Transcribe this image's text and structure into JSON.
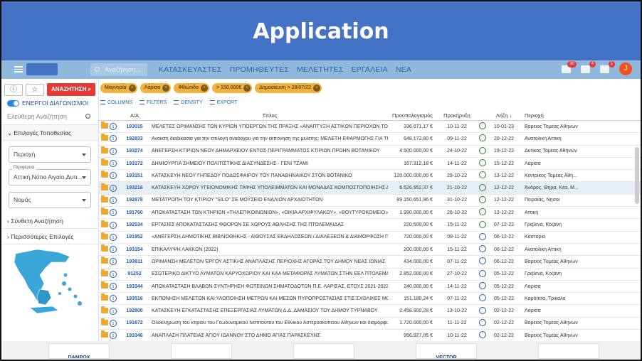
{
  "banner_title": "Application",
  "topbar": {
    "search_placeholder": "Αναζήτηση...",
    "nav": [
      "ΚΑΤΑΣΚΕΥΑΣΤΕΣ",
      "ΠΡΟΜΗΘΕΥΤΕΣ",
      "ΜΕΛΕΤΗΤΕΣ",
      "ΕΡΓΑΛΕΙΑ",
      "ΝΕΑ"
    ],
    "badges": {
      "messages": "30",
      "mail": "4",
      "bell": "1"
    },
    "avatar": "J"
  },
  "sidebar": {
    "search_button": "ΑΝΑΖΗΤΗΣΗ",
    "active_toggle": "ΕΝΕΡΓΟΙ ΔΙΑΓΩΝΙΣΜΟΙ",
    "free_search": "Ελεύθερη Αναζήτηση",
    "location_section": "Επιλογές Τοποθεσίας",
    "region_placeholder": "Περιοχή",
    "periphery_label": "Περιφέρεια",
    "periphery_value": "Αττική,Νότιο Αιγαίο,Δυτι...",
    "nomos_placeholder": "Νομός",
    "complex_search": "Σύνθετη Αναζήτηση",
    "more_options": "Περισσότερες Επιλογές"
  },
  "filters": [
    "Μαγνησία",
    "Λάρισα",
    "Φθιώτιδα",
    "> 150.000€",
    "Δημοσίευση > 28/07/22"
  ],
  "tools": [
    "COLUMNS",
    "FILTERS",
    "DENSITY",
    "EXPORT"
  ],
  "columns": {
    "aa": "Α/Α",
    "title": "Τίτλος",
    "budget": "Προϋπολογισμός",
    "notice": "Προκήρυξη",
    "expiry": "Λήξη",
    "region": "Περιοχή"
  },
  "rows": [
    {
      "id": "193015",
      "title": "ΜΕΛΕΤΕΣ ΩΡΙΜΑΝΣΗΣ ΤΩΝ ΚΥΡΙΩΝ ΥΠΟΕΡΓΩΝ ΤΗΣ ΠΡΑΞΗΣ «ΑΝΑΠΤΥΞΗ ΑΣΤΙΚΩΝ ΠΕΡΙΟΧΩΝ ΤΟΥ Δ...",
      "budget": "336.671,17 €",
      "notice": "10-11-22",
      "expiry": "10-01-23",
      "region": "Βόρειος Τομέας Αθηνών",
      "color": "green"
    },
    {
      "id": "192833",
      "title": "Ανοικτή διαδικασία για την επιλογή αναδόχου για την εκπόνηση της μελέτης: ΜΕΛΕΤΗ ΕΦΑΡΜΟΓΗΣ ΓΙΑ ΤΗΝ",
      "budget": "648.172,80 €",
      "notice": "09-11-22",
      "expiry": "20-12-22",
      "region": "Ανατολική Αττική",
      "color": "green"
    },
    {
      "id": "193274",
      "title": "ΑΝΕΓΕΡΣΗ ΚΤΙΡΙΩΝ ΝΕΟΥ ΔΗΜΑΡΧΕΙΟΥ ΕΝΤΟΣ ΠΕΡΙΓΡΑΜΜΑΤΟΣ ΚΤΙΡΙΩΝ ΠΡΩΗΝ ΒΟΤΑΝΙΚΟΥ",
      "budget": "4.500.000,00 €",
      "notice": "24-10-22",
      "expiry": "19-12-22",
      "region": "Δυτικός Τομέας Αθηνών",
      "color": "green"
    },
    {
      "id": "193172",
      "title": "ΔΗΜΙΟΥΡΓΙΑ ΣΗΜΕΙΟΥ ΠΟΛΙΤΙΣΤΙΚΗΣ ΔΙΑΣΥΝΔΕΣΗΣ - ΓΕΝΙ ΤΖΑΜΙ",
      "budget": "167.312,18 €",
      "notice": "14-11-22",
      "expiry": "15-12-22",
      "region": "Λάρισα",
      "color": "green"
    },
    {
      "id": "193151",
      "title": "ΚΑΤΑΣΚΕΥΗ ΝΕΟΥ ΓΗΠΕΔΟΥ ΠΟΔΟΣΦΑΙΡΟΥ ΤΟΥ ΠΑΝΑΘΗΝΑΪΚΟΥ ΣΤΟΝ ΒΟΤΑΝΙΚΟ",
      "budget": "120.000.000,00 €",
      "notice": "29-10-22",
      "expiry": "13-12-22",
      "region": "Κεντρικός Τομέας Αθη...",
      "color": "green"
    },
    {
      "id": "193216",
      "title": "ΚΑΤΑΣΚΕΥΗ ΧΩΡΟΥ ΥΓΕΙΟΝΟΜΙΚΗΣ ΤΑΦΗΣ ΥΠΟΛΕΙΜΜΑΤΩΝ ΚΑΙ ΜΟΝΑΔΑΣ ΚΟΜΠΟΣΤΟΠΟΙΗΣΗΣ ΔΗ...",
      "budget": "6.526.952,37 €",
      "notice": "21-10-22",
      "expiry": "12-12-22",
      "region": "Άνδρος, Θήρα, Κέα, Μ...",
      "color": "green"
    },
    {
      "id": "192878",
      "title": "ΜΕΤΑΤΡΟΠΗ ΤΟΥ ΚΤΙΡΙΟΥ \"SILO\" ΣΕ ΜΟΥΣΕΙΟ ΕΝΑΛΙΩΝ ΑΡΧΑΙΟΤΗΤΩΝ",
      "budget": "89.150.651,96 €",
      "notice": "31-10-22",
      "expiry": "12-12-22",
      "region": "Πειραιάς, Νήσοι",
      "color": "green"
    },
    {
      "id": "191760",
      "title": "ΑΠΟΚΑΤΑΣΤΑΣΗ ΤΩΝ ΚΤΗΡΙΩΝ «ΤΗΛΕΠΙΚΟΙΝΩΝΙΩΝ», «ΟΙΚΙΑ ΑΡΧΙΦΥΛΑΚΟΥ», «ΒΟΥΤΥΡΟΚΟΜΕΙΟ»",
      "budget": "1.990.000,00 €",
      "notice": "26-10-22",
      "expiry": "12-12-22",
      "region": "Αττική",
      "color": "green"
    },
    {
      "id": "192534",
      "title": "ΕΡΓΑΣΙΕΣ ΑΠΟΚΑΤΑΣΤΑΣΗΣ ΦΘΟΡΩΝ ΣΕ ΧΩΡΟΥΣ ΑΘΛΗΣΗΣ ΤΗΣ ΠΤΟΛΕΜΑΪΔΑΣ",
      "budget": "220.500,00 €",
      "notice": "15-11-22",
      "expiry": "07-12-22",
      "region": "Γρεβενά, Κοζάνη",
      "color": "green"
    },
    {
      "id": "191952",
      "title": "«ΑΝΕΓΕΡΣΗ ΔΗΜΟΤΙΚΗΣ ΒΙΒΛΙΟΘΗΚΗΣ - ΑΙΘΟΥΣΑΣ ΕΚΔΗΛΩΣΕΩΝ / ΔΙΑΛΕΞΕΩΝ & ΔΙΑΜΟΡΦΩΣΗ ΠΕΡ...",
      "budget": "720.000,00 €",
      "notice": "08-11-22",
      "expiry": "06-12-22",
      "region": "Καστοριά",
      "color": "blue"
    },
    {
      "id": "193154",
      "title": "ΕΠΙΚΑΛΥΨΗ ΛΑΚΚΩΝ (2022)",
      "budget": "200.000,00 €",
      "notice": "15-11-22",
      "expiry": "06-12-22",
      "region": "Ανατολική Αττική",
      "color": "blue"
    },
    {
      "id": "193811",
      "title": "ΩΡΙΜΑΝΣΗ ΜΕΛΕΤΩΝ ΈΡΓΟΥ ΑΣΤΙΚΗΣ ΑΝΑΠΛΑΣΗΣ ΠΕΡΙΟΧΗΣ ΑΓΟΡΑΣ ΤΟΥ ΔΗΜΟΥ ΝΕΑΣ ΙΩΝΙΑΣ",
      "budget": "434.000,00 €",
      "notice": "07-11-22",
      "expiry": "06-12-22",
      "region": "Βόρειος Τομέας Αθηνών",
      "color": "blue"
    },
    {
      "id": "91252",
      "title": "ΕΣΩΤΕΡΙΚΟ ΔΙΚΤΥΟ ΛΥΜΑΤΩΝ ΚΑΡΥΟΧΩΡΙΟΥ ΚΑΙ ΚΑΑ ΜΕΤΑΦΟΡΑΣ ΛΥΜΑΤΩΝ ΣΤΗΝ ΕΕΛ ΠΤΟΛΕΜΑΪ...",
      "budget": "2.852.000,00 €",
      "notice": "27-10-22",
      "expiry": "05-12-22",
      "region": "Γρεβενά, Κοζάνη",
      "color": "blue"
    },
    {
      "id": "193344",
      "title": "ΑΠΟΚΑΤΑΣΤΑΣΗ ΒΛΑΒΩΝ-ΣΥΝΤΗΡΗΣΗ ΦΩΤΕΙΝΩΝ ΣΗΜΑΤΟΔΟΤΩΝ Π.Ε. ΛΑΡΙΣΑΣ, ΕΤΟΥΣ 2021-2022",
      "budget": "240.000,00 €",
      "notice": "14-11-22",
      "expiry": "05-12-22",
      "region": "Λάρισα",
      "color": "blue"
    },
    {
      "id": "193516",
      "title": "ΕΚΠΟΝΗΣΗ ΜΕΛΕΤΩΝ ΚΑΙ ΥΛΟΠΟΙΗΣΗ ΜΕΤΡΩΝ ΚΑΙ ΜΕΣΩΝ ΠΥΡΟΠΡΟΣΤΑΣΙΑΣ ΣΤΙΣ ΣΧΟΛΙΚΕΣ ΜΟΝ...",
      "budget": "151.180,24 €",
      "notice": "07-11-22",
      "expiry": "05-12-22",
      "region": "Καρδίτσα, Τρίκαλα",
      "color": "blue"
    },
    {
      "id": "192800",
      "title": "ΚΑΤΑΣΚΕΥΗ ΕΓΚΑΤΑΣΤΑΣΗΣ ΕΠΕΞΕΡΓΑΣΙΑΣ ΛΥΜΑΤΩΝ Δ.Δ. ΔΑΜΑΣΙΟΥ ΤΟΥ ΔΗΜΟΥ ΤΥΡΝΑΒΟΥ",
      "budget": "2.458.900,28 €",
      "notice": "13-10-22",
      "expiry": "02-12-22",
      "region": "Λάρισα",
      "color": "blue"
    },
    {
      "id": "191672",
      "title": "Ολοκλήρωση του κτιρίου του Γεωδυναμικού Ινστιτούτου του Εθνικού Αστεροσκοπείου Αθηνών και διαμόρφωση",
      "budget": "1.720.000,00 €",
      "notice": "11-11-22",
      "expiry": "02-12-22",
      "region": "Βόρειος Τομέας Αθηνών",
      "color": "blue"
    },
    {
      "id": "193346",
      "title": "ΑΝΑΠΛΑΣΗ ΠΛΑΤΕΙΑΣ ΑΓΙΟΥ ΙΩΑΝΝΟΥ ΣΤΟ ΔΗΜΟ ΑΓΙΑΣ ΠΑΡΑΣΚΕΥΗΣ",
      "budget": "956.927,05 €",
      "notice": "10-11-22",
      "expiry": "02-12-22",
      "region": "Βόρειος Τομέας Αθηνών",
      "color": "blue"
    }
  ],
  "logos": [
    "DAMPOX",
    "",
    "",
    "VECTOR",
    ""
  ],
  "accent": "#4472c4"
}
